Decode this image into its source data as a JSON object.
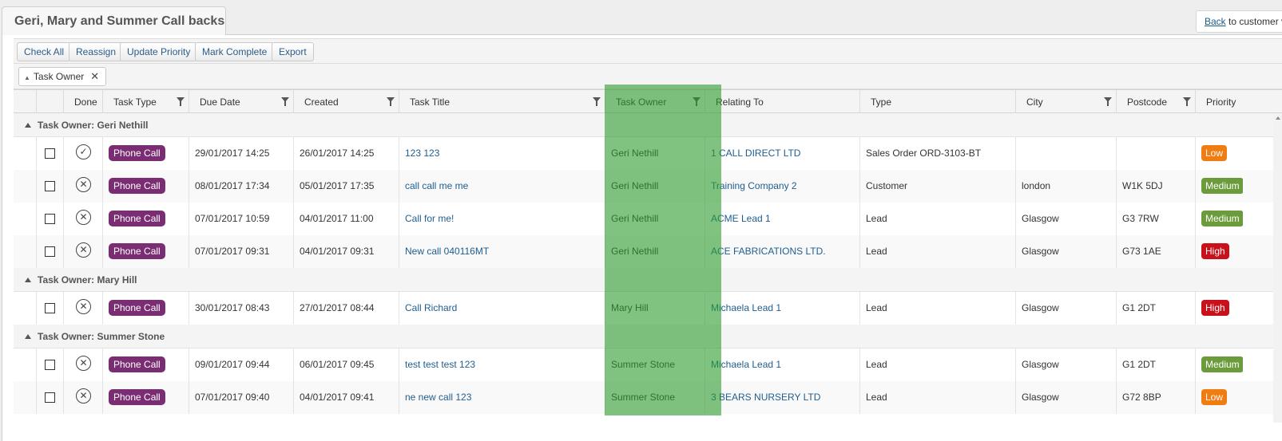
{
  "tab": {
    "title": "Geri, Mary and Summer Call backs"
  },
  "back": {
    "link": "Back",
    "rest": " to customer view"
  },
  "toolbar": {
    "buttons": [
      "Check All",
      "Reassign",
      "Update Priority",
      "Mark Complete",
      "Export"
    ]
  },
  "grouping": {
    "chip_label": "Task Owner"
  },
  "columns": [
    "",
    "",
    "Done",
    "Task Type",
    "Due Date",
    "Created",
    "Task Title",
    "Task Owner",
    "Relating To",
    "Type",
    "City",
    "Postcode",
    "Priority"
  ],
  "colors": {
    "task_type": "#7a2d73",
    "low": "#f07d12",
    "medium": "#6b9b3a",
    "high": "#c9101b",
    "highlight": "#2c9b2c"
  },
  "groups": [
    {
      "label": "Task Owner: Geri Nethill",
      "rows": [
        {
          "done": "check",
          "task_type": "Phone Call",
          "due": "29/01/2017 14:25",
          "created": "26/01/2017 14:25",
          "title": "123 123",
          "owner": "Geri Nethill",
          "relating": "1 CALL DIRECT LTD",
          "type": "Sales Order ORD-3103-BT",
          "city": "",
          "postcode": "",
          "priority": "Low"
        },
        {
          "done": "cross",
          "task_type": "Phone Call",
          "due": "08/01/2017 17:34",
          "created": "05/01/2017 17:35",
          "title": "call call me me",
          "owner": "Geri Nethill",
          "relating": "Training Company 2",
          "type": "Customer",
          "city": "london",
          "postcode": "W1K 5DJ",
          "priority": "Medium"
        },
        {
          "done": "cross",
          "task_type": "Phone Call",
          "due": "07/01/2017 10:59",
          "created": "04/01/2017 11:00",
          "title": "Call for me!",
          "owner": "Geri Nethill",
          "relating": "ACME Lead 1",
          "type": "Lead",
          "city": "Glasgow",
          "postcode": "G3 7RW",
          "priority": "Medium"
        },
        {
          "done": "cross",
          "task_type": "Phone Call",
          "due": "07/01/2017 09:31",
          "created": "04/01/2017 09:31",
          "title": "New call 040116MT",
          "owner": "Geri Nethill",
          "relating": "ACE FABRICATIONS LTD.",
          "type": "Lead",
          "city": "Glasgow",
          "postcode": "G73 1AE",
          "priority": "High"
        }
      ]
    },
    {
      "label": "Task Owner: Mary Hill",
      "rows": [
        {
          "done": "cross",
          "task_type": "Phone Call",
          "due": "30/01/2017 08:43",
          "created": "27/01/2017 08:44",
          "title": "Call Richard",
          "owner": "Mary Hill",
          "relating": "Michaela Lead 1",
          "type": "Lead",
          "city": "Glasgow",
          "postcode": "G1 2DT",
          "priority": "High"
        }
      ]
    },
    {
      "label": "Task Owner: Summer Stone",
      "rows": [
        {
          "done": "cross",
          "task_type": "Phone Call",
          "due": "09/01/2017 09:44",
          "created": "06/01/2017 09:45",
          "title": "test test test 123",
          "owner": "Summer Stone",
          "relating": "Michaela Lead 1",
          "type": "Lead",
          "city": "Glasgow",
          "postcode": "G1 2DT",
          "priority": "Medium"
        },
        {
          "done": "cross",
          "task_type": "Phone Call",
          "due": "07/01/2017 09:40",
          "created": "04/01/2017 09:41",
          "title": "ne new call 123",
          "owner": "Summer Stone",
          "relating": "3 BEARS NURSERY LTD",
          "type": "Lead",
          "city": "Glasgow",
          "postcode": "G72 8BP",
          "priority": "Low"
        }
      ]
    }
  ]
}
